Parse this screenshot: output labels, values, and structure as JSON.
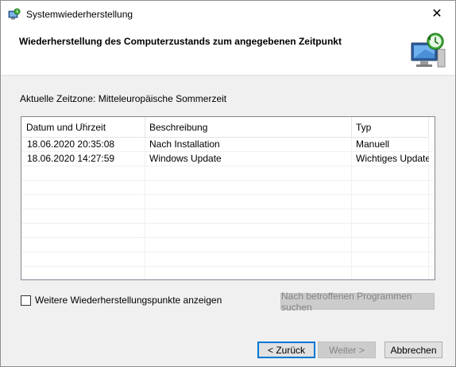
{
  "window": {
    "title": "Systemwiederherstellung",
    "close_glyph": "✕"
  },
  "header": {
    "title": "Wiederherstellung des Computerzustands zum angegebenen Zeitpunkt",
    "icon": "system-restore-monitor-icon"
  },
  "timezone": {
    "label": "Aktuelle Zeitzone:",
    "value": "Mitteleuropäische Sommerzeit"
  },
  "table": {
    "columns": [
      "Datum und Uhrzeit",
      "Beschreibung",
      "Typ"
    ],
    "sorted_column": "Datum und Uhrzeit",
    "sort_direction": "descending",
    "rows": [
      [
        "18.06.2020 20:35:08",
        "Nach Installation",
        "Manuell"
      ],
      [
        "18.06.2020 14:27:59",
        "Windows Update",
        "Wichtiges Update"
      ]
    ]
  },
  "more_points": {
    "label": "Weitere Wiederherstellungspunkte anzeigen",
    "checked": false
  },
  "buttons": {
    "scan": "Nach betroffenen Programmen suchen",
    "back": "< Zurück",
    "next": "Weiter >",
    "cancel": "Abbrechen"
  },
  "colors": {
    "accent": "#0078d7",
    "window_bg": "#f0f0f0"
  }
}
